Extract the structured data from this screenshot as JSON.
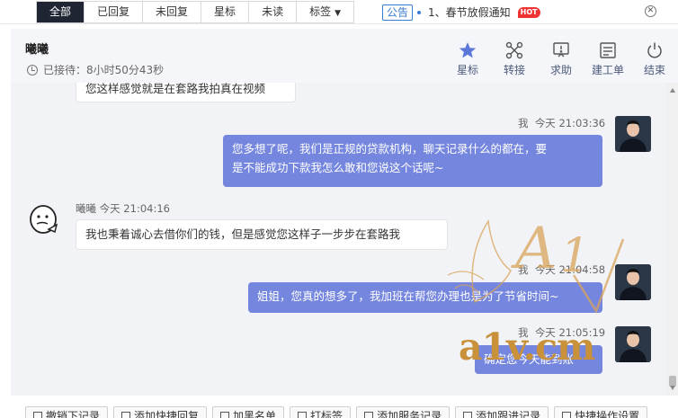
{
  "filters": {
    "tabs": [
      "全部",
      "已回复",
      "未回复",
      "星标",
      "未读",
      "标签"
    ],
    "active": "全部"
  },
  "notice": {
    "tag": "公告",
    "text": "1、春节放假通知",
    "badge": "HOT"
  },
  "session": {
    "customer_name": "曦曦",
    "timer": "已接待：8小时50分43秒",
    "actions": [
      {
        "label": "星标",
        "icon": "star-icon"
      },
      {
        "label": "转接",
        "icon": "transfer-icon"
      },
      {
        "label": "求助",
        "icon": "help-icon"
      },
      {
        "label": "建工单",
        "icon": "ticket-icon"
      },
      {
        "label": "结束",
        "icon": "power-icon"
      }
    ]
  },
  "messages": {
    "m0": {
      "text": "您这样感觉就是在套路我拍真在视频"
    },
    "m1": {
      "sender": "我",
      "time": "今天 21:03:36",
      "text_1": "您多想了呢，我们是正规的贷款机构，聊天记录什么的都在，要",
      "text_2": "是不能成功下款我怎么敢和您说这个话呢~"
    },
    "m2": {
      "sender": "曦曦",
      "time": "今天 21:04:16",
      "text": "我也秉着诚心去借你们的钱，但是感觉您这样子一步步在套路我"
    },
    "m3": {
      "sender": "我",
      "time": "今天 21:04:58",
      "text": "姐姐，您真的想多了，我加班在帮您办理也是为了节省时间~"
    },
    "m4": {
      "sender": "我",
      "time": "今天 21:05:19",
      "text": "确定您今天能到账"
    }
  },
  "toolbar": [
    "撤销下记录",
    "添加快捷回复",
    "加黑名单",
    "打标签",
    "添加服务记录",
    "添加跟进记录",
    "快捷操作设置"
  ],
  "watermark": {
    "text": "a1v.cm",
    "logo": "A1v"
  },
  "colors": {
    "accent": "#7586de",
    "active_tab": "#1f2533",
    "watermark": "#c8913a"
  }
}
